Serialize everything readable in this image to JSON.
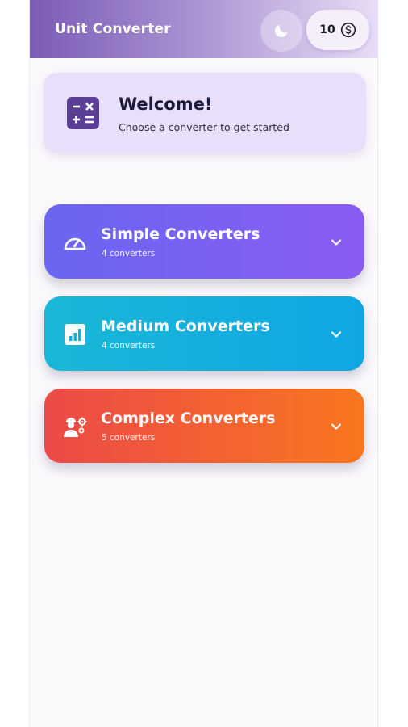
{
  "header": {
    "title": "Unit Converter",
    "theme_toggle_icon": "moon-icon",
    "coins": {
      "count": "10",
      "icon": "dollar-coin-icon"
    }
  },
  "welcome": {
    "icon": "calculator-icon",
    "title": "Welcome!",
    "subtitle": "Choose a converter to get started"
  },
  "categories": [
    {
      "icon": "speedometer-icon",
      "title": "Simple Converters",
      "count_label": "4 converters",
      "color_start": "#6966f2",
      "color_end": "#8a5cf4",
      "expanded": false
    },
    {
      "icon": "bar-chart-icon",
      "title": "Medium Converters",
      "count_label": "4 converters",
      "color_start": "#19b7d6",
      "color_end": "#0fa6e4",
      "expanded": false
    },
    {
      "icon": "engineer-gears-icon",
      "title": "Complex Converters",
      "count_label": "5 converters",
      "color_start": "#ec4a48",
      "color_end": "#f9761e",
      "expanded": false
    }
  ],
  "colors": {
    "header_start": "#7a5cb7",
    "welcome_bg": "#eadffb",
    "app_bg": "#fcf9fd"
  }
}
